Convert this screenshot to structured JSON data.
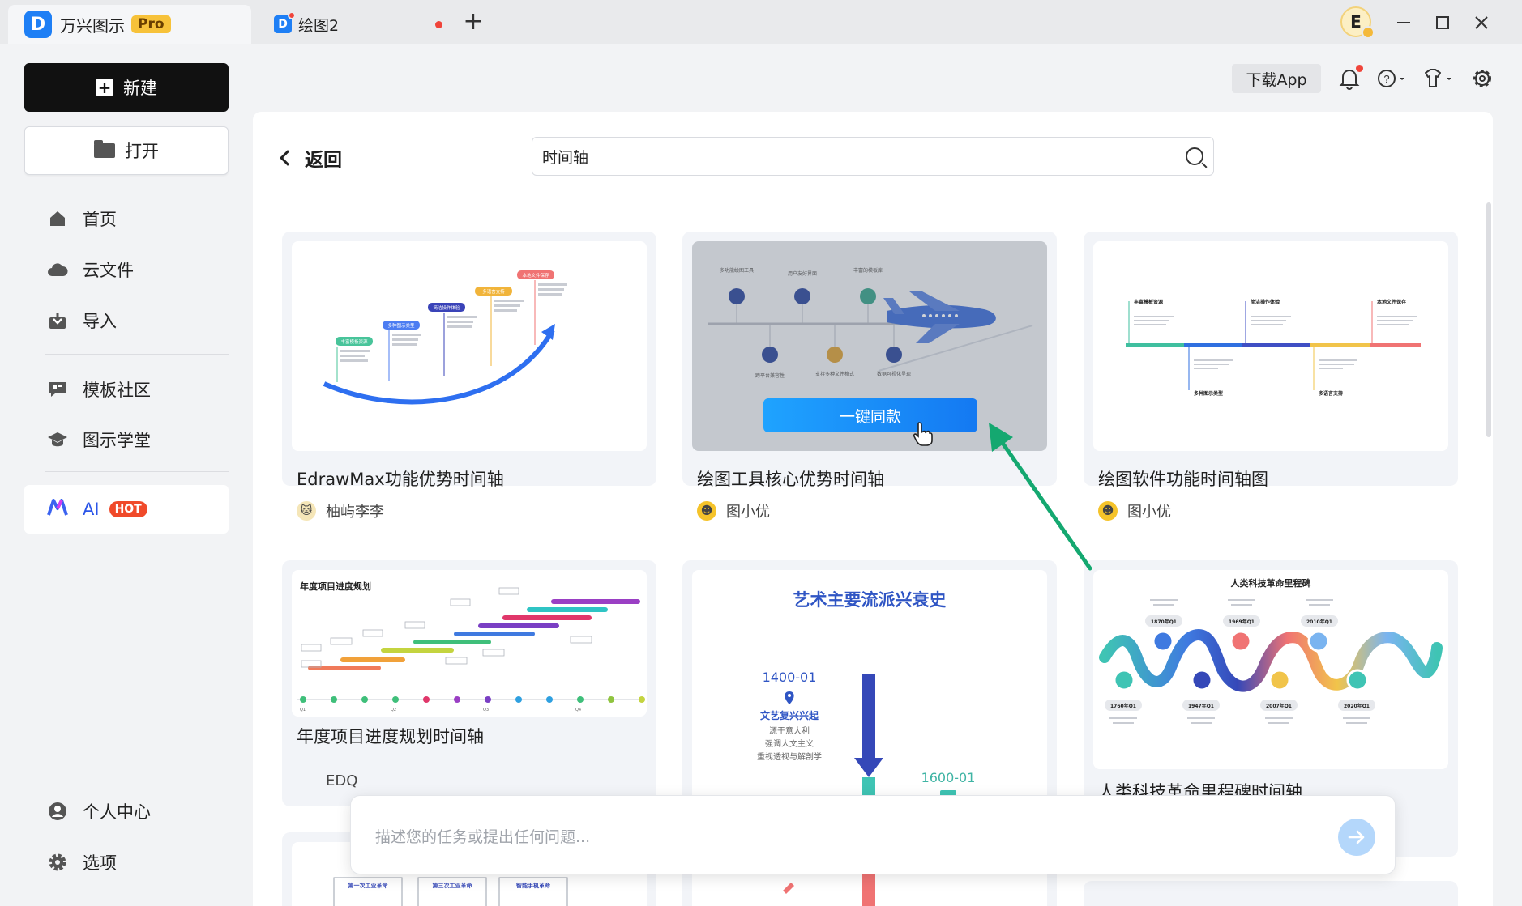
{
  "titlebar": {
    "app_tab": {
      "logo": "D",
      "name": "万兴图示",
      "badge": "Pro"
    },
    "doc_tab": {
      "logo": "D",
      "name": "绘图2"
    },
    "new_tab": "+",
    "avatar_letter": "E",
    "window_controls": [
      "minimize-icon",
      "maximize-icon",
      "close-icon"
    ]
  },
  "sidebar": {
    "new_label": "新建",
    "open_label": "打开",
    "items": [
      {
        "label": "首页",
        "icon": "home-icon"
      },
      {
        "label": "云文件",
        "icon": "cloud-icon"
      },
      {
        "label": "导入",
        "icon": "import-icon"
      },
      {
        "label": "模板社区",
        "icon": "community-icon"
      },
      {
        "label": "图示学堂",
        "icon": "graduation-cap-icon"
      }
    ],
    "ai": {
      "label": "AI",
      "badge": "HOT"
    },
    "bottom_items": [
      {
        "label": "个人中心",
        "icon": "user-icon"
      },
      {
        "label": "选项",
        "icon": "gear-icon"
      }
    ]
  },
  "toolbar": {
    "download_label": "下载App",
    "icons": [
      "bell-icon",
      "help-icon",
      "shirt-icon",
      "settings-icon"
    ]
  },
  "main": {
    "back_label": "返回",
    "search": {
      "value": "时间轴"
    },
    "cards": [
      {
        "title": "EdrawMax功能优势时间轴",
        "author": "柚屿李李",
        "steps": [
          "丰富模板资源",
          "多种图示类型",
          "简洁操作体验",
          "多语言支持",
          "本地文件保存"
        ]
      },
      {
        "title": "绘图工具核心优势时间轴",
        "author": "图小优",
        "hover_button": "一键同款",
        "top_labels": [
          "多功能绘图工具",
          "用户友好界面",
          "丰富的模板库"
        ],
        "bottom_labels": [
          "跨平台兼容性",
          "支持多种文件格式",
          "数据可视化呈现"
        ]
      },
      {
        "title": "绘图软件功能时间轴图",
        "author": "图小优",
        "top_labels": [
          "丰富模板资源",
          "简洁操作体验",
          "本地文件保存"
        ],
        "bottom_labels": [
          "多种图示类型",
          "多语言支持"
        ]
      },
      {
        "title": "年度项目进度规划时间轴",
        "author": "EDQ",
        "heading": "年度项目进度规划",
        "quarters": [
          "Q1",
          "Q2",
          "Q3",
          "Q4"
        ]
      },
      {
        "title": "艺术主要流派兴衰史",
        "author": "",
        "heading": "艺术主要流派兴衰史",
        "event1": {
          "date": "1400-01",
          "name": "文艺复兴兴起",
          "lines": [
            "源于意大利",
            "强调人文主义",
            "重视透视与解剖学"
          ]
        },
        "event2": {
          "date": "1600-01"
        }
      },
      {
        "title": "人类科技革命里程碑时间轴",
        "author": "",
        "heading": "人类科技革命里程碑",
        "top_dates": [
          "1870年Q1",
          "1969年Q1",
          "2010年Q1"
        ],
        "bottom_dates": [
          "1760年Q1",
          "1947年Q1",
          "2007年Q1",
          "2020年Q1"
        ]
      }
    ],
    "row3_labels": [
      "第一次工业革命",
      "第三次工业革命",
      "智能手机革命"
    ]
  },
  "chat": {
    "placeholder": "描述您的任务或提出任何问题..."
  },
  "colors": {
    "accent": "#1e7ff5",
    "arrow": "#14a870",
    "hot": "#f04a2a"
  }
}
